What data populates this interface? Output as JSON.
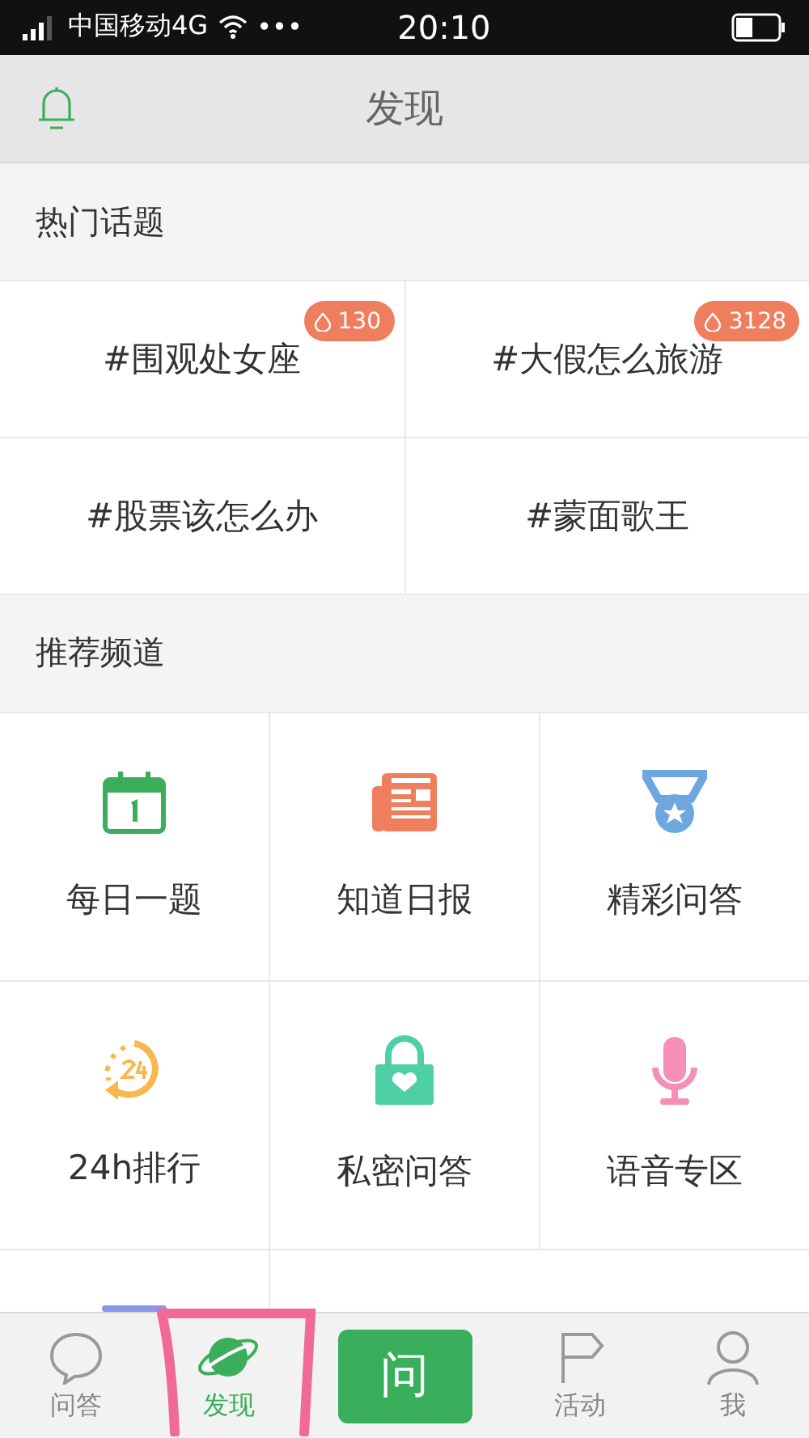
{
  "status_bar": {
    "carrier": "中国移动4G",
    "more": "•••",
    "time": "20:10"
  },
  "header": {
    "title": "发现"
  },
  "hot_topics": {
    "title": "热门话题",
    "items": [
      {
        "label": "#围观处女座",
        "badge": "130"
      },
      {
        "label": "#大假怎么旅游",
        "badge": "3128"
      },
      {
        "label": "#股票该怎么办"
      },
      {
        "label": "#蒙面歌王"
      }
    ]
  },
  "channels": {
    "title": "推荐频道",
    "items": [
      {
        "label": "每日一题"
      },
      {
        "label": "知道日报"
      },
      {
        "label": "精彩问答"
      },
      {
        "label": "24h排行"
      },
      {
        "label": "私密问答"
      },
      {
        "label": "语音专区"
      }
    ]
  },
  "tab_bar": {
    "tabs": [
      {
        "label": "问答",
        "selected": false
      },
      {
        "label": "发现",
        "selected": true
      },
      {
        "label": "活动",
        "selected": false
      },
      {
        "label": "我",
        "selected": false
      }
    ],
    "ask_button": {
      "label": "问"
    }
  }
}
